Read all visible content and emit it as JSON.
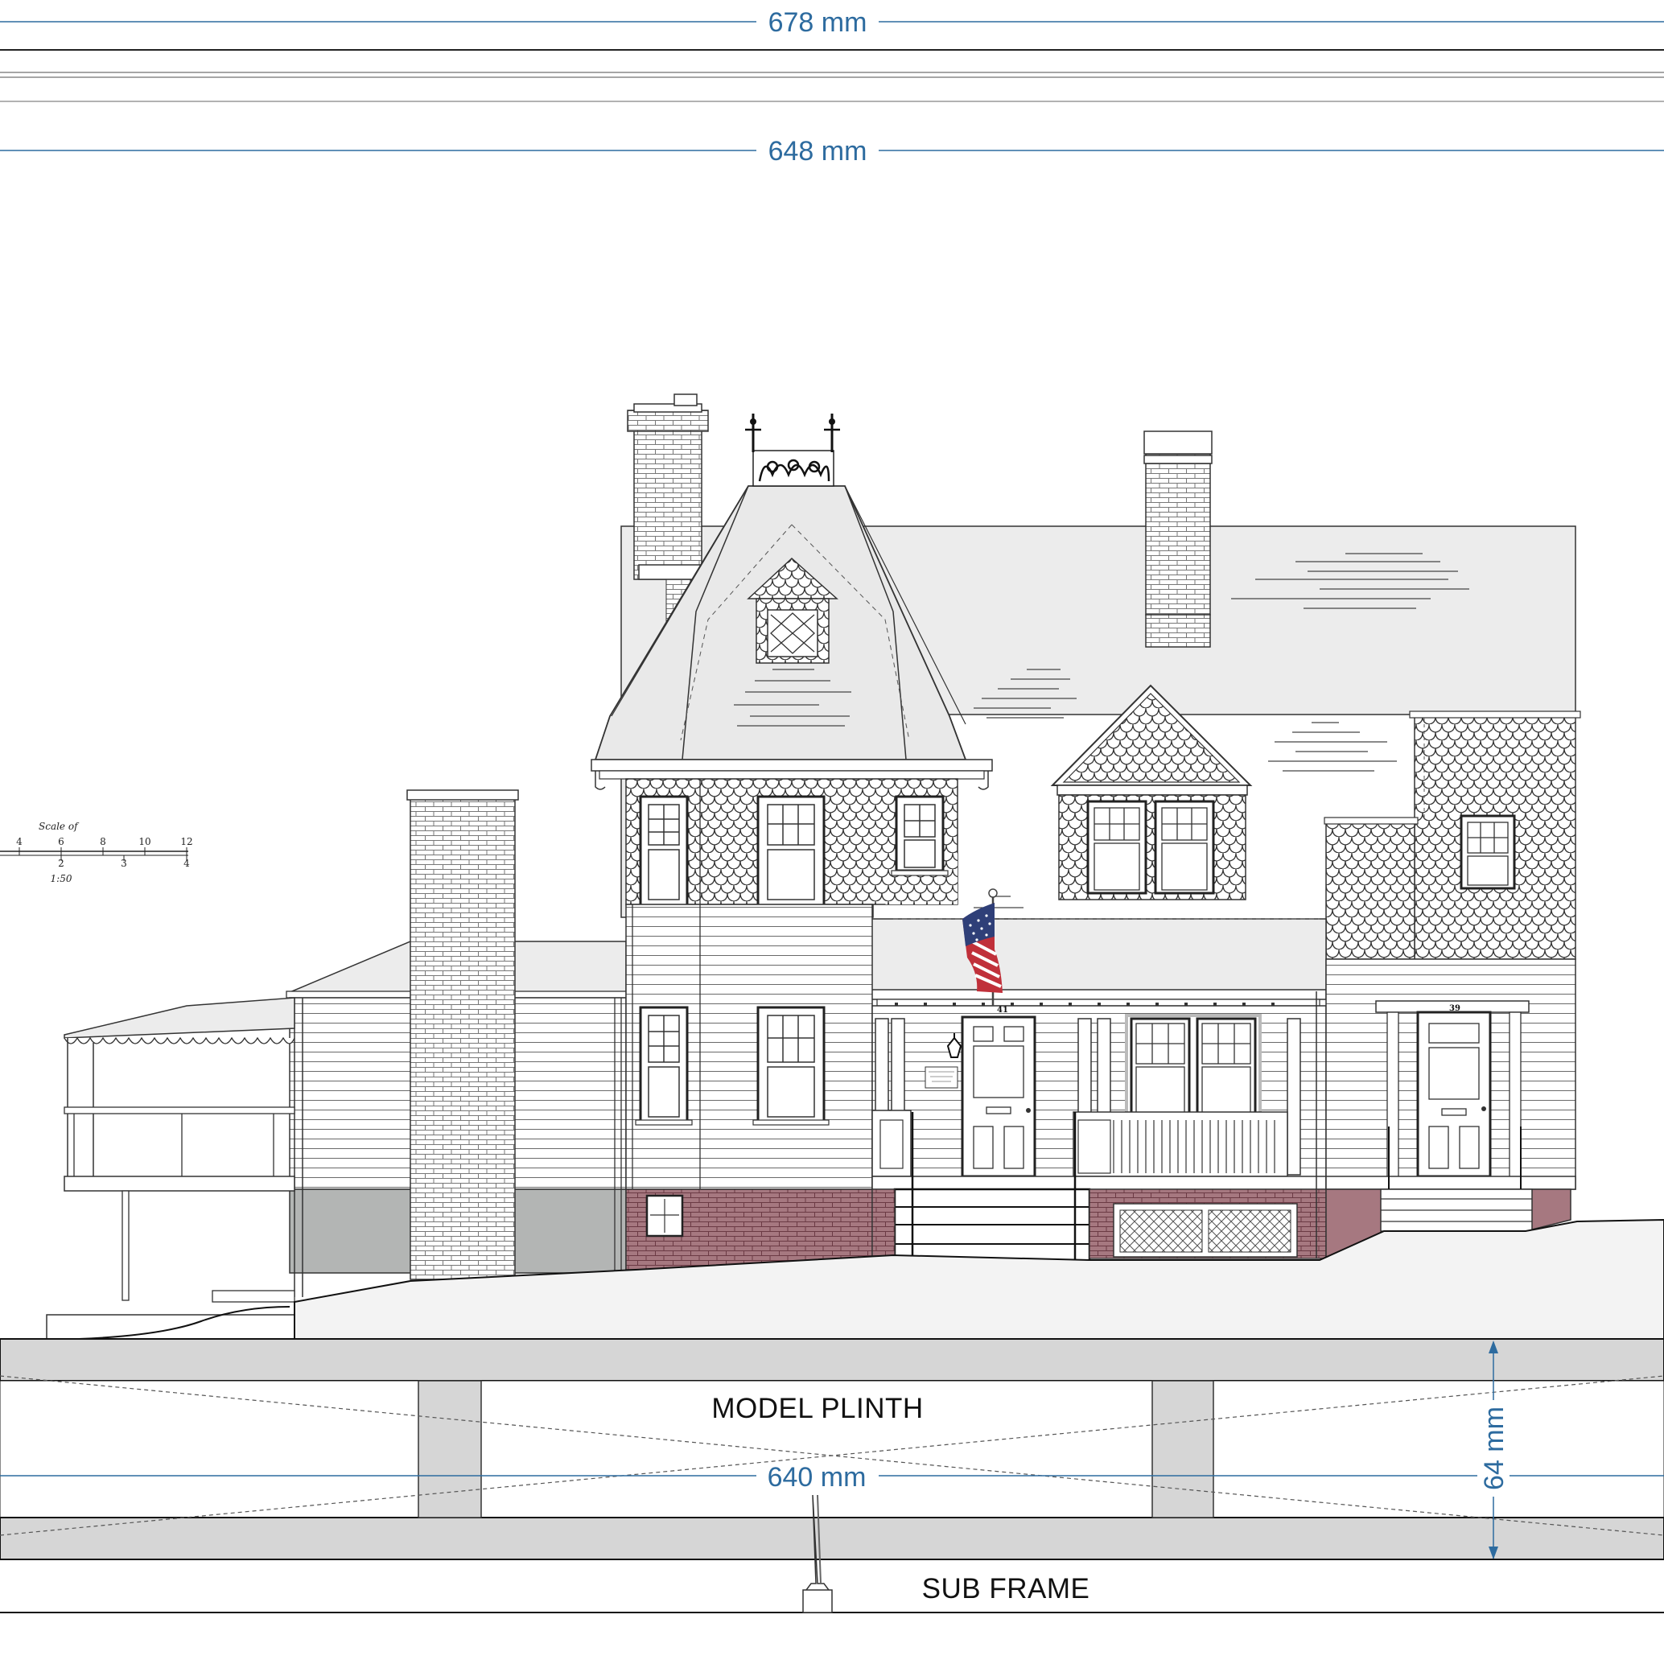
{
  "dimensions": {
    "overall_width": "678 mm",
    "house_width": "648 mm",
    "plinth_width": "640 mm",
    "plinth_height": "64 mm"
  },
  "labels": {
    "plinth": "MODEL PLINTH",
    "sub_frame": "SUB FRAME"
  },
  "scale_bar": {
    "title": "Scale of",
    "ratio": "1:50",
    "top_ticks": [
      "4",
      "6",
      "8",
      "10",
      "12"
    ],
    "bottom_ticks": [
      "2",
      "3",
      "4"
    ]
  },
  "house_numbers": {
    "left_door": "41",
    "right_door": "39"
  },
  "colors": {
    "dimension_blue": "#2d6b9f",
    "brick_red": "#a67880",
    "foundation_grey": "#b3b5b4",
    "roof_grey": "#ececec",
    "plinth_grey": "#d6d6d6"
  }
}
